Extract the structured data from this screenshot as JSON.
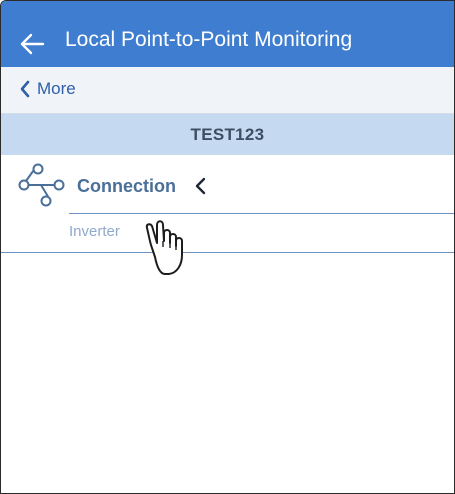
{
  "header": {
    "title": "Local Point-to-Point Monitoring",
    "back_icon": "arrow-left-icon",
    "bg_color": "#3e7dcf"
  },
  "nav": {
    "more_label": "More",
    "more_icon": "chevron-left-icon"
  },
  "device": {
    "name": "TEST123",
    "bg_color": "#c5daf1"
  },
  "menu": {
    "connection": {
      "label": "Connection",
      "icon": "connection-icon",
      "state_icon": "chevron-left-icon"
    },
    "items": [
      {
        "label": "Inverter"
      }
    ]
  },
  "overlay": {
    "cursor_icon": "hand-pointer-icon"
  }
}
